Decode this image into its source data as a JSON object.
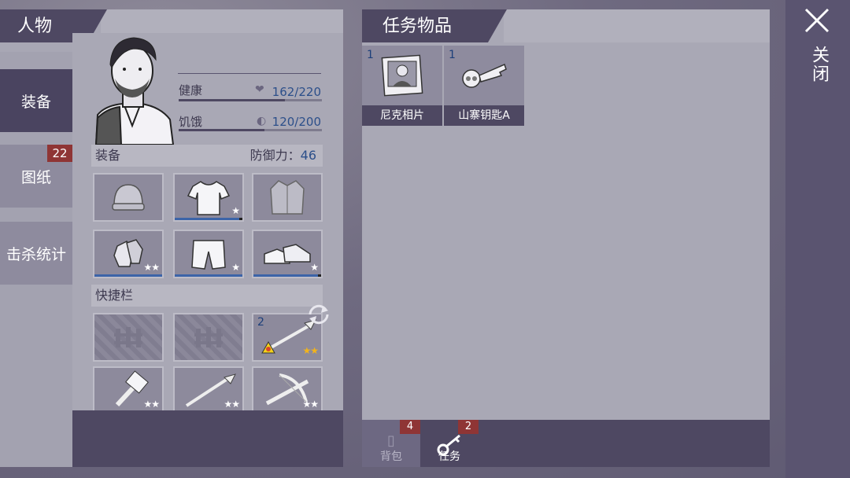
{
  "left": {
    "title": "人物",
    "sidebar": [
      {
        "label": "装备",
        "active": true
      },
      {
        "label": "图纸",
        "badge": "22"
      },
      {
        "label": "击杀统计"
      }
    ]
  },
  "stats": {
    "health_label": "健康",
    "health_value": "162/220",
    "health_fraction": 0.74,
    "hunger_label": "饥饿",
    "hunger_value": "120/200",
    "hunger_fraction": 0.6
  },
  "equipment": {
    "label": "装备",
    "defense_label": "防御力：",
    "defense_value": "46",
    "slots": [
      {
        "name": "beanie-icon",
        "stars": ""
      },
      {
        "name": "tshirt-icon",
        "stars": "★"
      },
      {
        "name": "jacket-icon",
        "stars": ""
      },
      {
        "name": "gloves-icon",
        "stars": "★★"
      },
      {
        "name": "shorts-icon",
        "stars": "★"
      },
      {
        "name": "sneakers-icon",
        "stars": "★"
      }
    ]
  },
  "quickbar": {
    "label": "快捷栏",
    "slots": [
      {
        "name": "locked-fence-icon",
        "locked": true
      },
      {
        "name": "locked-fence-icon",
        "locked": true
      },
      {
        "name": "spear-fire-icon",
        "count": "2",
        "stars": "★★",
        "gold": true
      },
      {
        "name": "hammer-icon",
        "stars": "★★"
      },
      {
        "name": "spear-icon",
        "stars": "★★"
      },
      {
        "name": "crossbow-icon",
        "stars": "★★"
      }
    ]
  },
  "mid": {
    "title": "任务物品",
    "items": [
      {
        "count": "1",
        "name": "尼克相片"
      },
      {
        "count": "1",
        "name": "山寨钥匙A"
      }
    ],
    "tabs": [
      {
        "label": "背包",
        "badge": "4"
      },
      {
        "label": "任务",
        "badge": "2"
      }
    ]
  },
  "close": {
    "label": "关闭"
  }
}
